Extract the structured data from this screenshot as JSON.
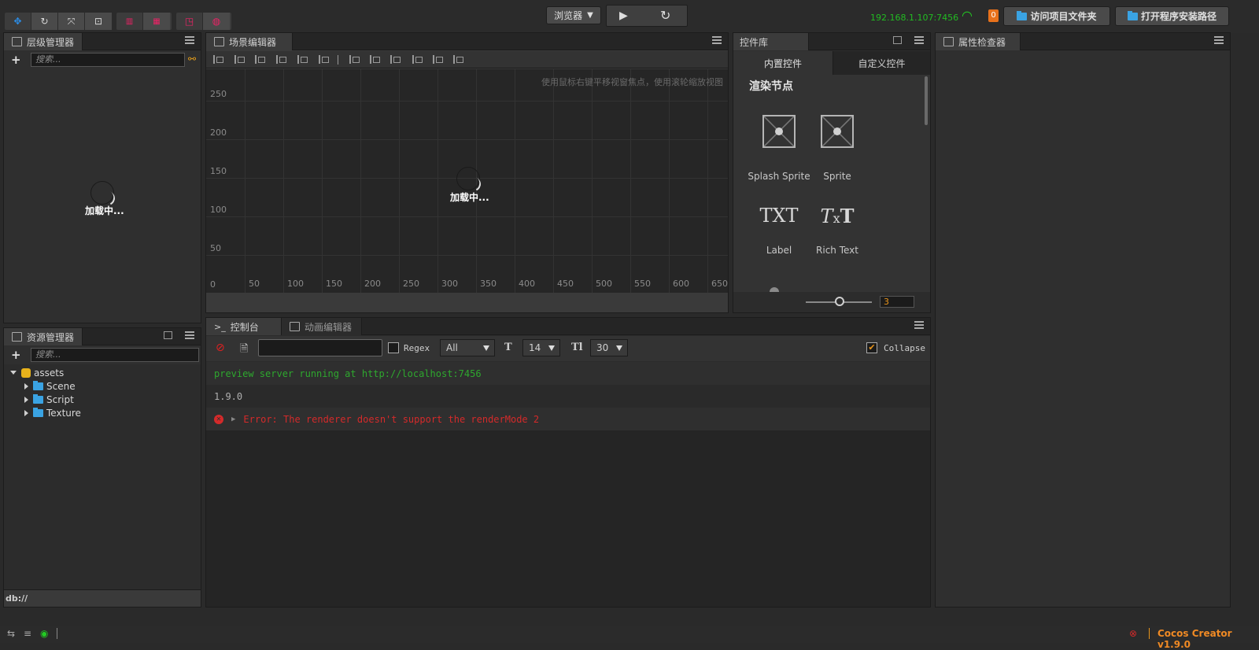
{
  "toolbar": {
    "preview_target": "浏览器",
    "ip_address": "192.168.1.107:7456",
    "notification_count": "0",
    "open_project_folder": "访问项目文件夹",
    "open_install_path": "打开程序安装路径",
    "colors": {
      "ip": "#22bb22",
      "badge": "#e8711b",
      "accent_blue": "#2c8ee8"
    }
  },
  "hierarchy": {
    "title": "层级管理器",
    "search_placeholder": "搜索...",
    "loading": "加载中..."
  },
  "assets": {
    "title": "资源管理器",
    "search_placeholder": "搜索...",
    "root": "assets",
    "folders": [
      "Scene",
      "Script",
      "Texture"
    ],
    "footer": "db://"
  },
  "scene": {
    "title": "场景编辑器",
    "hint": "使用鼠标右键平移视窗焦点，使用滚轮缩放视图",
    "loading": "加载中...",
    "y_ticks": [
      "250",
      "200",
      "150",
      "100",
      "50"
    ],
    "x_ticks": [
      "0",
      "50",
      "100",
      "150",
      "200",
      "250",
      "300",
      "350",
      "400",
      "450",
      "500",
      "550",
      "600",
      "650"
    ]
  },
  "widgets": {
    "title": "控件库",
    "tab_builtin": "内置控件",
    "tab_custom": "自定义控件",
    "section": "渲染节点",
    "items": [
      "Splash Sprite",
      "Sprite",
      "Label",
      "Rich Text"
    ],
    "label_icon_text": "TXT",
    "rich_icon_parts": [
      "T",
      "x",
      "T"
    ],
    "zoom_value": "3"
  },
  "inspector": {
    "title": "属性检查器"
  },
  "console": {
    "title": "控制台",
    "anim_tab": "动画编辑器",
    "regex_label": "Regex",
    "level_filter": "All",
    "font_size": "14",
    "line_height": "30",
    "collapse_label": "Collapse",
    "collapse_checked": true,
    "logs": [
      {
        "text": "preview server running at http://localhost:7456",
        "color": "#2ea82e"
      },
      {
        "text": "1.9.0",
        "color": "#b0b0b0"
      },
      {
        "text": "Error: The renderer doesn't support the renderMode 2",
        "color": "#d42a2a"
      }
    ]
  },
  "status": {
    "version": "Cocos Creator v1.9.0",
    "version_color": "#f08a24"
  }
}
